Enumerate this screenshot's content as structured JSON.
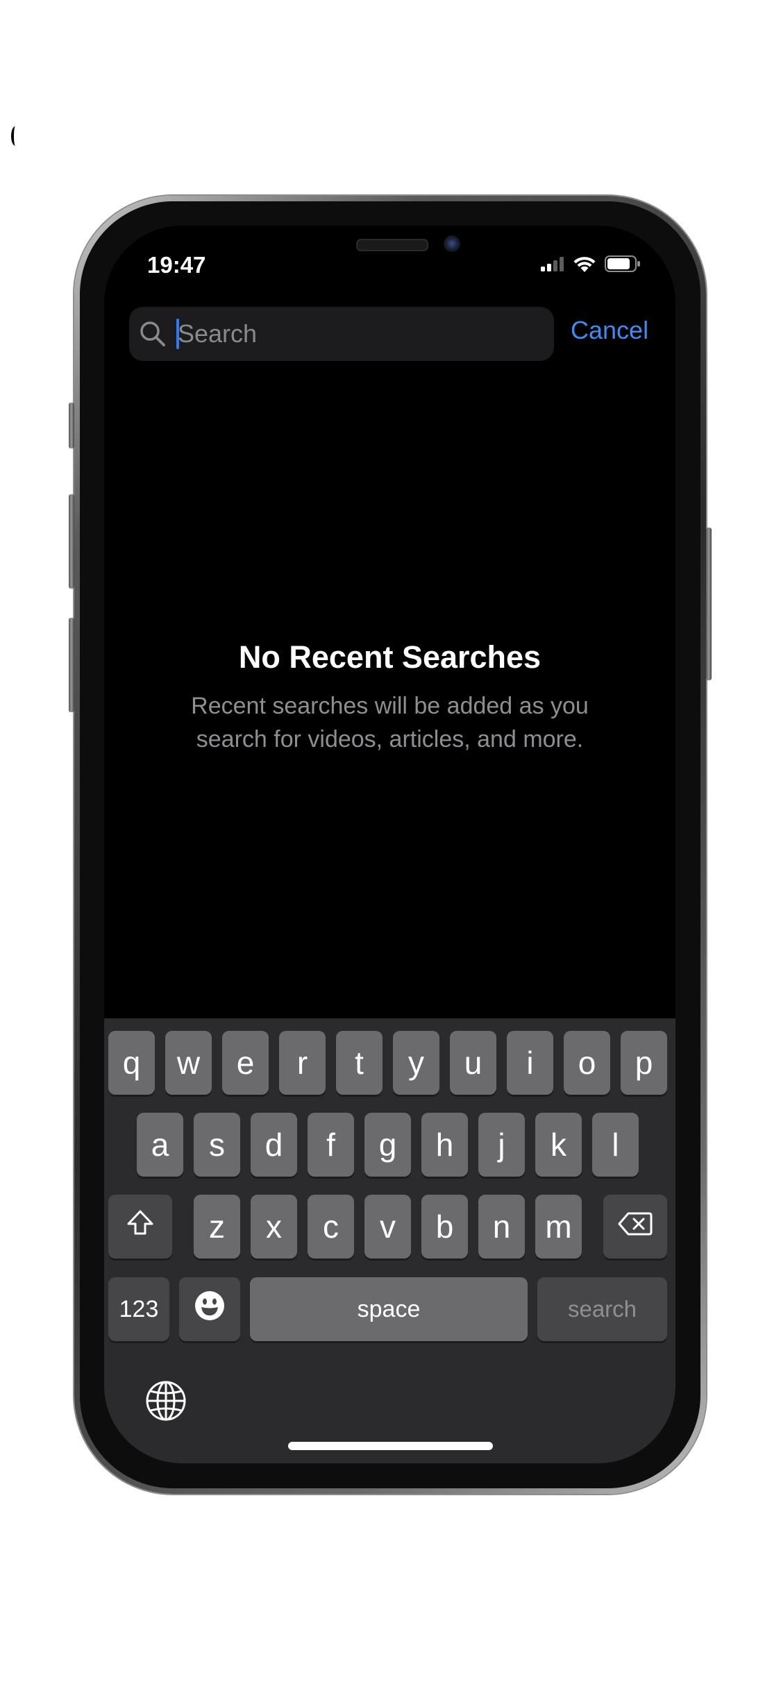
{
  "status_bar": {
    "time": "19:47",
    "icons": [
      "cellular-signal-icon",
      "wifi-icon",
      "battery-icon"
    ]
  },
  "search": {
    "placeholder": "Search",
    "value": "",
    "cancel_label": "Cancel"
  },
  "empty_state": {
    "title": "No Recent Searches",
    "description": "Recent searches will be added as you search for videos, articles, and more."
  },
  "keyboard": {
    "row1": [
      "q",
      "w",
      "e",
      "r",
      "t",
      "y",
      "u",
      "i",
      "o",
      "p"
    ],
    "row2": [
      "a",
      "s",
      "d",
      "f",
      "g",
      "h",
      "j",
      "k",
      "l"
    ],
    "row3": [
      "z",
      "x",
      "c",
      "v",
      "b",
      "n",
      "m"
    ],
    "numbers_label": "123",
    "space_label": "space",
    "return_label": "search",
    "icons": [
      "shift-icon",
      "delete-icon",
      "emoji-icon",
      "globe-icon"
    ]
  },
  "colors": {
    "accent": "#3b8cf3",
    "background": "#000000",
    "key": "#6b6b6d",
    "key_function": "#464648"
  }
}
